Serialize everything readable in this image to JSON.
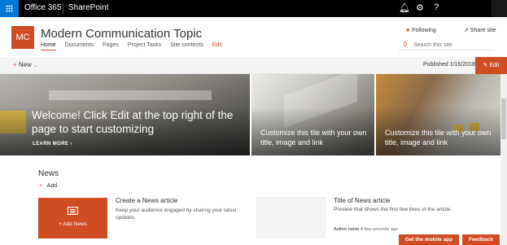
{
  "suite_bar": {
    "app_name": "Office 365",
    "product": "SharePoint",
    "icons": [
      "bell-icon",
      "gear-icon",
      "help-icon"
    ],
    "accent": "#0078d7"
  },
  "site": {
    "logo_initials": "MC",
    "title": "Modern Communication Topic",
    "accent": "#d04c23",
    "nav": [
      "Home",
      "Documents",
      "Pages",
      "Project Tasks",
      "Site contents",
      "Edit"
    ],
    "following_label": "Following",
    "share_label": "Share site",
    "search_placeholder": "Search this site"
  },
  "command_bar": {
    "new_label": "New",
    "published": "Published 1/16/2018",
    "edit_label": "Edit"
  },
  "hero": {
    "main_title": "Welcome! Click Edit at the top right of the page to start customizing",
    "learn_more": "LEARN MORE",
    "tile2_text": "Customize this tile with your own title, image and link",
    "tile3_text": "Customize this tile with your own title, image and link"
  },
  "news": {
    "heading": "News",
    "add_label": "Add",
    "add_news_label": "Add News",
    "article1": {
      "title": "Create a News article",
      "desc": "Keep your audience engaged by sharing your latest updates."
    },
    "article2": {
      "title": "Title of News article",
      "desc": "Preview that shows the first few lines of the article.",
      "author": "Author name",
      "time": "A few seconds ago"
    }
  },
  "footer_buttons": {
    "mobile_app": "Get the mobile app",
    "feedback": "Feedback"
  }
}
